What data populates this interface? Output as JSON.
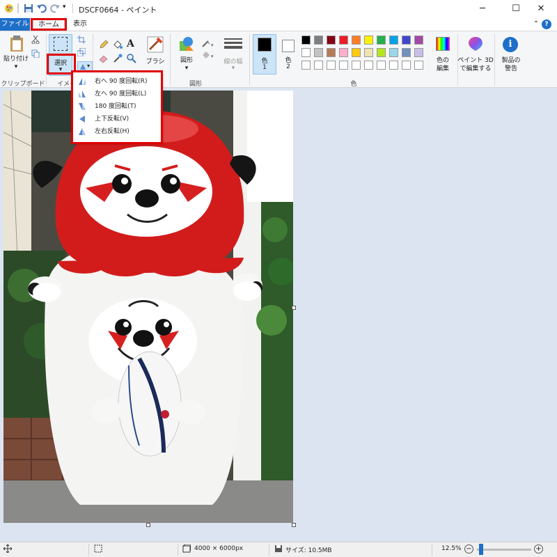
{
  "window": {
    "title": "DSCF0664 - ペイント",
    "minimize": "─",
    "maximize": "☐",
    "close": "✕"
  },
  "tabs": {
    "file": "ファイル",
    "home": "ホーム",
    "view": "表示"
  },
  "ribbon": {
    "clipboard": {
      "paste": "貼り付け",
      "group": "クリップボード"
    },
    "image": {
      "select": "選択",
      "group": "イメージ"
    },
    "tools": {
      "brush": "ブラシ"
    },
    "shapes": {
      "shape": "図形",
      "line_width": "線の幅",
      "group": "図形"
    },
    "colors": {
      "color1": "色",
      "color1_num": "1",
      "color2": "色",
      "color2_num": "2",
      "edit": "色の\n編集",
      "edit_l1": "色の",
      "edit_l2": "編集",
      "group": "色",
      "palette_row1": [
        "#000000",
        "#7f7f7f",
        "#880015",
        "#ed1c24",
        "#ff7f27",
        "#fff200",
        "#22b14c",
        "#00a2e8",
        "#3f48cc",
        "#a349a4"
      ],
      "palette_row2": [
        "#ffffff",
        "#c3c3c3",
        "#b97a57",
        "#ffaec9",
        "#ffc90e",
        "#efe4b0",
        "#b5e61d",
        "#99d9ea",
        "#7092be",
        "#c8bfe7"
      ],
      "palette_row3": [
        "#ffffff",
        "#ffffff",
        "#ffffff",
        "#ffffff",
        "#ffffff",
        "#ffffff",
        "#ffffff",
        "#ffffff",
        "#ffffff",
        "#ffffff"
      ]
    },
    "paint3d": {
      "l1": "ペイント 3D",
      "l2": "で編集する"
    },
    "product_alert": {
      "l1": "製品の",
      "l2": "警告"
    }
  },
  "rotate_menu": {
    "items": [
      {
        "label": "右へ 90 度回転(R)"
      },
      {
        "label": "左へ 90 度回転(L)"
      },
      {
        "label": "180 度回転(T)"
      },
      {
        "label": "上下反転(V)"
      },
      {
        "label": "左右反転(H)"
      }
    ]
  },
  "status": {
    "dimensions": "4000 × 6000px",
    "size": "サイズ: 10.5MB",
    "zoom": "12.5%",
    "zoom_out": "−",
    "zoom_in": "+",
    "zoom_level": 0.125
  }
}
